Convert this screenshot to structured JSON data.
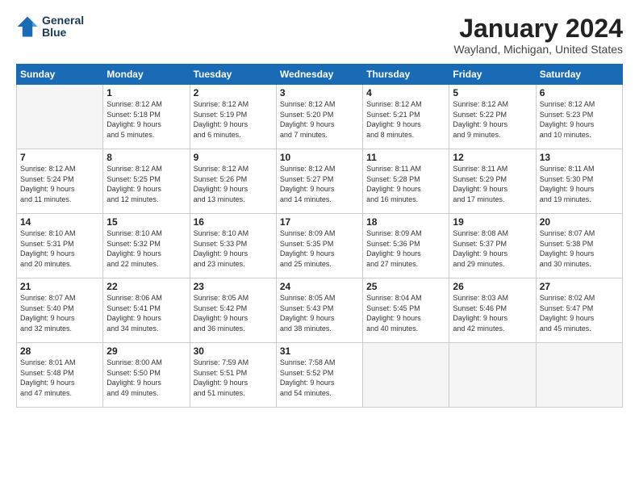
{
  "logo": {
    "line1": "General",
    "line2": "Blue"
  },
  "title": "January 2024",
  "location": "Wayland, Michigan, United States",
  "days_header": [
    "Sunday",
    "Monday",
    "Tuesday",
    "Wednesday",
    "Thursday",
    "Friday",
    "Saturday"
  ],
  "weeks": [
    [
      {
        "day": "",
        "content": ""
      },
      {
        "day": "1",
        "content": "Sunrise: 8:12 AM\nSunset: 5:18 PM\nDaylight: 9 hours\nand 5 minutes."
      },
      {
        "day": "2",
        "content": "Sunrise: 8:12 AM\nSunset: 5:19 PM\nDaylight: 9 hours\nand 6 minutes."
      },
      {
        "day": "3",
        "content": "Sunrise: 8:12 AM\nSunset: 5:20 PM\nDaylight: 9 hours\nand 7 minutes."
      },
      {
        "day": "4",
        "content": "Sunrise: 8:12 AM\nSunset: 5:21 PM\nDaylight: 9 hours\nand 8 minutes."
      },
      {
        "day": "5",
        "content": "Sunrise: 8:12 AM\nSunset: 5:22 PM\nDaylight: 9 hours\nand 9 minutes."
      },
      {
        "day": "6",
        "content": "Sunrise: 8:12 AM\nSunset: 5:23 PM\nDaylight: 9 hours\nand 10 minutes."
      }
    ],
    [
      {
        "day": "7",
        "content": "Sunrise: 8:12 AM\nSunset: 5:24 PM\nDaylight: 9 hours\nand 11 minutes."
      },
      {
        "day": "8",
        "content": "Sunrise: 8:12 AM\nSunset: 5:25 PM\nDaylight: 9 hours\nand 12 minutes."
      },
      {
        "day": "9",
        "content": "Sunrise: 8:12 AM\nSunset: 5:26 PM\nDaylight: 9 hours\nand 13 minutes."
      },
      {
        "day": "10",
        "content": "Sunrise: 8:12 AM\nSunset: 5:27 PM\nDaylight: 9 hours\nand 14 minutes."
      },
      {
        "day": "11",
        "content": "Sunrise: 8:11 AM\nSunset: 5:28 PM\nDaylight: 9 hours\nand 16 minutes."
      },
      {
        "day": "12",
        "content": "Sunrise: 8:11 AM\nSunset: 5:29 PM\nDaylight: 9 hours\nand 17 minutes."
      },
      {
        "day": "13",
        "content": "Sunrise: 8:11 AM\nSunset: 5:30 PM\nDaylight: 9 hours\nand 19 minutes."
      }
    ],
    [
      {
        "day": "14",
        "content": "Sunrise: 8:10 AM\nSunset: 5:31 PM\nDaylight: 9 hours\nand 20 minutes."
      },
      {
        "day": "15",
        "content": "Sunrise: 8:10 AM\nSunset: 5:32 PM\nDaylight: 9 hours\nand 22 minutes."
      },
      {
        "day": "16",
        "content": "Sunrise: 8:10 AM\nSunset: 5:33 PM\nDaylight: 9 hours\nand 23 minutes."
      },
      {
        "day": "17",
        "content": "Sunrise: 8:09 AM\nSunset: 5:35 PM\nDaylight: 9 hours\nand 25 minutes."
      },
      {
        "day": "18",
        "content": "Sunrise: 8:09 AM\nSunset: 5:36 PM\nDaylight: 9 hours\nand 27 minutes."
      },
      {
        "day": "19",
        "content": "Sunrise: 8:08 AM\nSunset: 5:37 PM\nDaylight: 9 hours\nand 29 minutes."
      },
      {
        "day": "20",
        "content": "Sunrise: 8:07 AM\nSunset: 5:38 PM\nDaylight: 9 hours\nand 30 minutes."
      }
    ],
    [
      {
        "day": "21",
        "content": "Sunrise: 8:07 AM\nSunset: 5:40 PM\nDaylight: 9 hours\nand 32 minutes."
      },
      {
        "day": "22",
        "content": "Sunrise: 8:06 AM\nSunset: 5:41 PM\nDaylight: 9 hours\nand 34 minutes."
      },
      {
        "day": "23",
        "content": "Sunrise: 8:05 AM\nSunset: 5:42 PM\nDaylight: 9 hours\nand 36 minutes."
      },
      {
        "day": "24",
        "content": "Sunrise: 8:05 AM\nSunset: 5:43 PM\nDaylight: 9 hours\nand 38 minutes."
      },
      {
        "day": "25",
        "content": "Sunrise: 8:04 AM\nSunset: 5:45 PM\nDaylight: 9 hours\nand 40 minutes."
      },
      {
        "day": "26",
        "content": "Sunrise: 8:03 AM\nSunset: 5:46 PM\nDaylight: 9 hours\nand 42 minutes."
      },
      {
        "day": "27",
        "content": "Sunrise: 8:02 AM\nSunset: 5:47 PM\nDaylight: 9 hours\nand 45 minutes."
      }
    ],
    [
      {
        "day": "28",
        "content": "Sunrise: 8:01 AM\nSunset: 5:48 PM\nDaylight: 9 hours\nand 47 minutes."
      },
      {
        "day": "29",
        "content": "Sunrise: 8:00 AM\nSunset: 5:50 PM\nDaylight: 9 hours\nand 49 minutes."
      },
      {
        "day": "30",
        "content": "Sunrise: 7:59 AM\nSunset: 5:51 PM\nDaylight: 9 hours\nand 51 minutes."
      },
      {
        "day": "31",
        "content": "Sunrise: 7:58 AM\nSunset: 5:52 PM\nDaylight: 9 hours\nand 54 minutes."
      },
      {
        "day": "",
        "content": ""
      },
      {
        "day": "",
        "content": ""
      },
      {
        "day": "",
        "content": ""
      }
    ]
  ]
}
